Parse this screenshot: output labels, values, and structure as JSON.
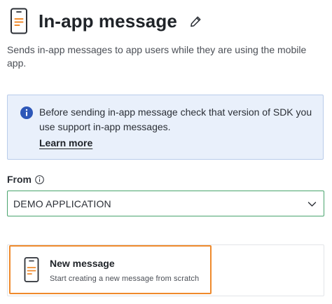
{
  "header": {
    "title": "In-app message",
    "app_icon": "mobile-app-icon",
    "edit_icon": "pencil-icon"
  },
  "subtitle": "Sends in-app messages to app users while they are using the mobile app.",
  "info_box": {
    "icon": "info-icon",
    "text": "Before sending in-app message check that version of SDK you use support in-app messages.",
    "link_label": "Learn more"
  },
  "from_field": {
    "label": "From",
    "label_icon": "info-outline-icon",
    "selected_value": "DEMO APPLICATION",
    "dropdown_icon": "chevron-down-icon"
  },
  "templates": {
    "new_message": {
      "title": "New message",
      "description": "Start creating a new message from scratch",
      "icon": "mobile-app-icon"
    }
  },
  "colors": {
    "accent_orange": "#ef8a2c",
    "info_blue": "#2d57b8",
    "info_bg": "#e9f0fb",
    "select_border_green": "#49a46d"
  }
}
